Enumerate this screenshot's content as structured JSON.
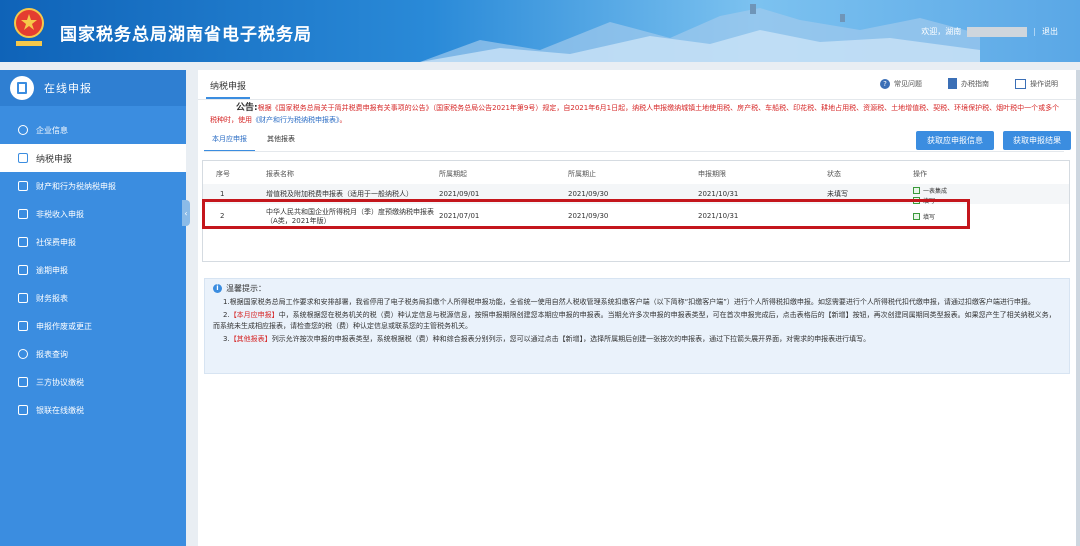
{
  "header": {
    "site_title": "国家税务总局湖南省电子税务局",
    "welcome": "欢迎，湖南",
    "separator": "|",
    "logout": "退出"
  },
  "sidebar": {
    "title": "在线申报",
    "items": [
      {
        "label": "企业信息",
        "icon": "building-icon"
      },
      {
        "label": "纳税申报",
        "icon": "doc-icon"
      },
      {
        "label": "财产和行为税纳税申报",
        "icon": "doc-icon"
      },
      {
        "label": "非税收入申报",
        "icon": "doc-icon"
      },
      {
        "label": "社保费申报",
        "icon": "doc-icon"
      },
      {
        "label": "逾期申报",
        "icon": "doc-icon"
      },
      {
        "label": "财务报表",
        "icon": "report-icon"
      },
      {
        "label": "申报作废或更正",
        "icon": "doc-icon"
      },
      {
        "label": "报表查询",
        "icon": "search-icon"
      },
      {
        "label": "三方协议缴税",
        "icon": "doc-icon"
      },
      {
        "label": "银联在线缴税",
        "icon": "doc-icon"
      }
    ],
    "collapse_glyph": "‹"
  },
  "main": {
    "tab": "纳税申报",
    "top_links": [
      "常见问题",
      "办税指南",
      "操作说明"
    ],
    "notice_label": "公告:",
    "notice_pre": "根据《国家税务总局关于简并税费申报有关事项的公告》（国家税务总局公告2021年第9号）规定，自2021年6月1日起，纳税人申报缴纳城镇土地使用税、房产税、车船税、印花税、耕地占用税、资源税、土地增值税、契税、环境保护税、烟叶税中一个或多个税种时，使用",
    "notice_link": "《财产和行为税纳税申报表》",
    "notice_post": "。",
    "subtabs": [
      "本月应申报",
      "其他报表"
    ],
    "buttons": [
      "获取应申报信息",
      "获取申报结果"
    ],
    "table": {
      "headers": [
        "序号",
        "报表名称",
        "所属期起",
        "所属期止",
        "申报期限",
        "状态",
        "操作"
      ],
      "rows": [
        {
          "no": "1",
          "name": "增值税及附加税费申报表（适用于一般纳税人）",
          "start": "2021/09/01",
          "end": "2021/09/30",
          "deadline": "2021/10/31",
          "status": "未填写",
          "ops": [
            "一表集成",
            "填写"
          ]
        },
        {
          "no": "2",
          "name": "中华人民共和国企业所得税月（季）度预缴纳税申报表（A类，2021年版）",
          "start": "2021/07/01",
          "end": "2021/09/30",
          "deadline": "2021/10/31",
          "status": "",
          "ops": [
            "填写"
          ]
        }
      ]
    },
    "tips": {
      "title": "温馨提示：",
      "p1": "1.根据国家税务总局工作要求和安排部署，我省停用了电子税务局扣缴个人所得税申报功能，全省统一使用自然人税收管理系统扣缴客户端（以下简称“扣缴客户端”）进行个人所得税扣缴申报。如您需要进行个人所得税代扣代缴申报，请通过扣缴客户端进行申报。",
      "p2_num": "2.",
      "p2_tag": "【本月应申报】",
      "p2_text": "中，系统根据您在税务机关的税（费）种认定信息与税源信息，按照申报期限创建您本期应申报的申报表。当期允许多次申报的申报表类型，可在首次申报完成后，点击表格后的【新增】按钮，再次创建同属期同类型报表。如果您产生了相关纳税义务，而系统未生成相应报表，请检查您的税（费）种认定信息或联系您的主管税务机关。",
      "p3_num": "3.",
      "p3_tag": "【其他报表】",
      "p3_text": "列示允许按次申报的申报表类型，系统根据税（费）种和综合报表分别列示，您可以通过点击【新增】，选择所属期后创建一张按次的申报表，通过下拉箭头展开界面，对需求的申报表进行填写。"
    }
  },
  "colors": {
    "accent": "#3b8de0",
    "highlight": "#c4161c",
    "notice": "#d62727"
  }
}
